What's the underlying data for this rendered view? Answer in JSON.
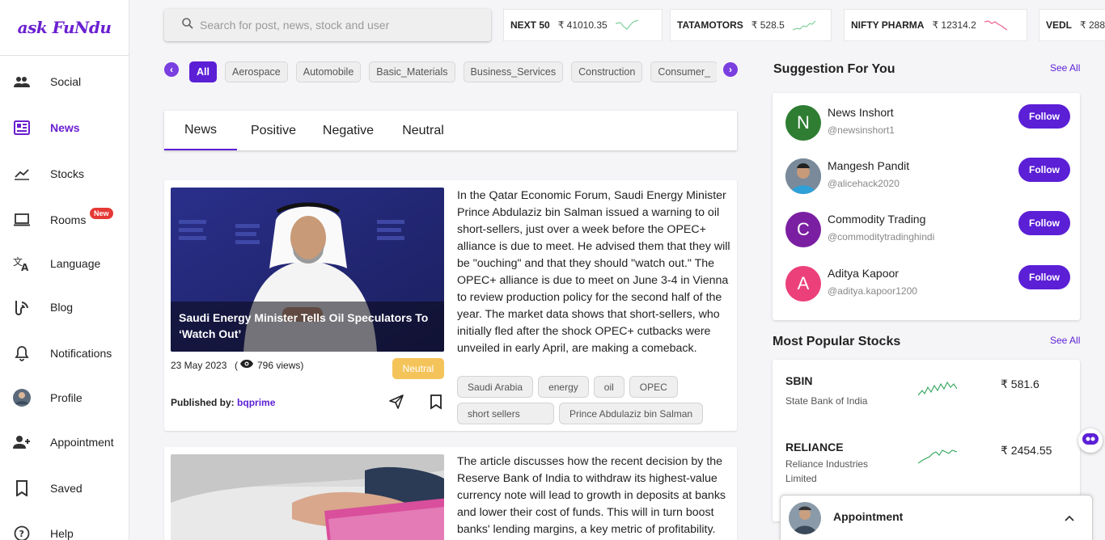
{
  "logo": "ask FuNdu",
  "sidebar": {
    "items": [
      {
        "label": "Social"
      },
      {
        "label": "News"
      },
      {
        "label": "Stocks"
      },
      {
        "label": "Rooms",
        "badge": "New"
      },
      {
        "label": "Language"
      },
      {
        "label": "Blog"
      },
      {
        "label": "Notifications"
      },
      {
        "label": "Profile"
      },
      {
        "label": "Appointment"
      },
      {
        "label": "Saved"
      },
      {
        "label": "Help"
      }
    ],
    "active": "News"
  },
  "search": {
    "placeholder": "Search for post, news, stock and user"
  },
  "tickers": [
    {
      "name": "NEXT 50",
      "price": "₹ 41010.35",
      "trend": "mixed"
    },
    {
      "name": "TATAMOTORS",
      "price": "₹ 528.5",
      "trend": "up"
    },
    {
      "name": "NIFTY PHARMA",
      "price": "₹ 12314.2",
      "trend": "down"
    },
    {
      "name": "VEDL",
      "price": "₹ 288"
    }
  ],
  "categories": [
    "All",
    "Aerospace",
    "Automobile",
    "Basic_Materials",
    "Business_Services",
    "Construction",
    "Consumer_"
  ],
  "tabs": [
    "News",
    "Positive",
    "Negative",
    "Neutral"
  ],
  "articles": [
    {
      "image_caption": "Saudi Energy Minister Tells Oil Speculators To ‘Watch Out’",
      "body": "In the Qatar Economic Forum, Saudi Energy Minister Prince Abdulaziz bin Salman issued a warning to oil short-sellers, just over a week before the OPEC+ alliance is due to meet. He advised them that they will be \"ouching\" and that they should \"watch out.\" The OPEC+ alliance is due to meet on June 3-4 in Vienna to review production policy for the second half of the year. The market data shows that short-sellers, who initially fled after the shock OPEC+ cutbacks were unveiled in early April, are making a comeback.",
      "date": "23 May 2023",
      "views": "796 views",
      "sentiment": "Neutral",
      "published_label": "Published by:",
      "author": "bqprime",
      "tags": [
        "Saudi Arabia",
        "energy",
        "oil",
        "OPEC",
        "short sellers",
        "Prince Abdulaziz bin Salman"
      ]
    },
    {
      "body": "The article discusses how the recent decision by the Reserve Bank of India to withdraw its highest-value currency note will lead to growth in deposits at banks and lower their cost of funds. This will in turn boost banks' lending margins, a key metric of profitability."
    }
  ],
  "suggestions": {
    "title": "Suggestion For You",
    "see_all": "See All",
    "follow_label": "Follow",
    "users": [
      {
        "name": "News Inshort",
        "handle": "@newsinshort1",
        "initial": "N",
        "color": "#2e7d32"
      },
      {
        "name": "Mangesh Pandit",
        "handle": "@alicehack2020",
        "initial": "",
        "color": "#4a6a8a"
      },
      {
        "name": "Commodity Trading",
        "handle": "@commoditytradinghindi",
        "initial": "C",
        "color": "#7b1fa2"
      },
      {
        "name": "Aditya Kapoor",
        "handle": "@aditya.kapoor1200",
        "initial": "A",
        "color": "#ec407a"
      }
    ]
  },
  "popular_stocks": {
    "title": "Most Popular Stocks",
    "see_all": "See All",
    "stocks": [
      {
        "symbol": "SBIN",
        "company": "State Bank of India",
        "price": "₹ 581.6"
      },
      {
        "symbol": "RELIANCE",
        "company": "Reliance Industries Limited",
        "price": "₹ 2454.55"
      }
    ]
  },
  "appointment_bar": {
    "title": "Appointment"
  },
  "colors": {
    "accent": "#5b1fd6",
    "positive": "#2ea55a",
    "negative": "#e8638f",
    "neutral_badge": "#f4c35a"
  }
}
